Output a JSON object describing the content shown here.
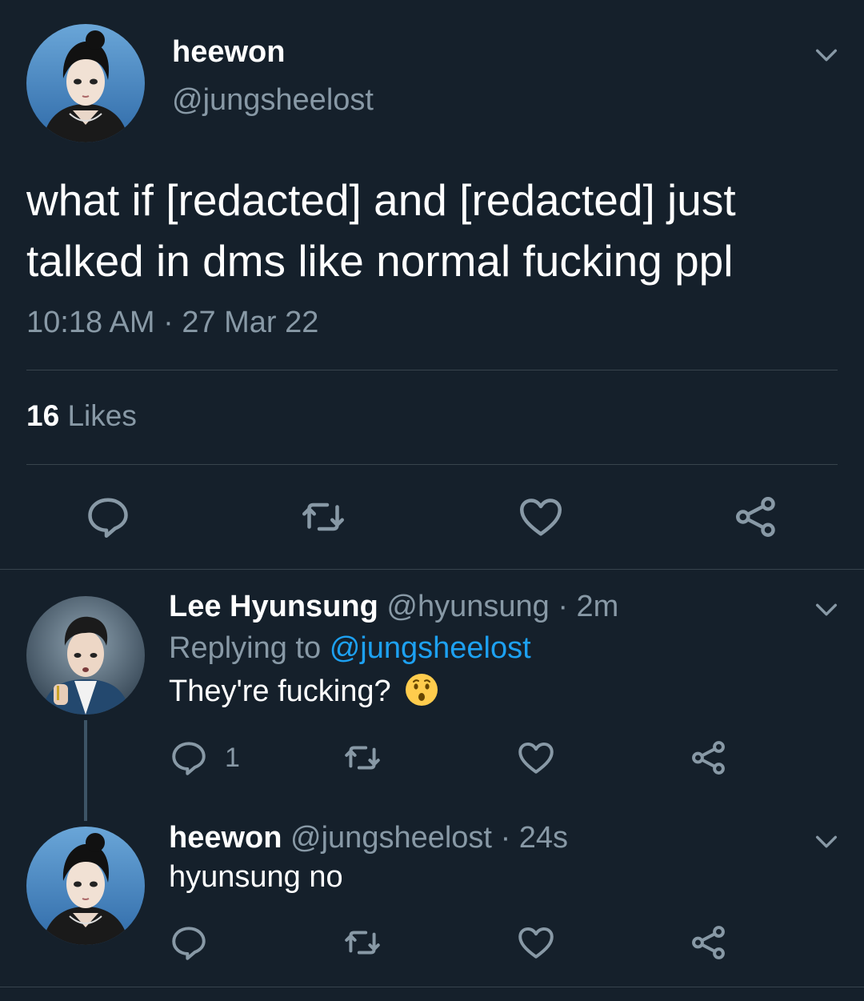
{
  "main_tweet": {
    "author_name": "heewon",
    "author_handle": "@jungsheelost",
    "avatar": "avatar-anime-woman",
    "text_line_1": "what if [redacted] and [redacted] just",
    "text_line_2": "talked in dms like normal fucking ppl",
    "timestamp": "10:18 AM · 27 Mar 22",
    "likes_count": "16",
    "likes_label": "Likes",
    "actions": [
      "reply-icon",
      "retweet-icon",
      "like-icon",
      "share-icon"
    ]
  },
  "replies": [
    {
      "author_name": "Lee Hyunsung",
      "author_handle": "@hyunsung",
      "time": "· 2m",
      "replying_to_prefix": "Replying to",
      "replying_to_handle": "@jungsheelost",
      "text": "They're fucking?",
      "emoji": "hushed-face-emoji",
      "reply_count": "1",
      "avatar": "avatar-anime-man"
    },
    {
      "author_name": "heewon",
      "author_handle": "@jungsheelost",
      "time": "· 24s",
      "text": "hyunsung no",
      "avatar": "avatar-anime-woman"
    }
  ],
  "colors": {
    "background": "#15202b",
    "secondary_text": "#8899a6",
    "link": "#1da1f2",
    "divider": "#38444d"
  }
}
